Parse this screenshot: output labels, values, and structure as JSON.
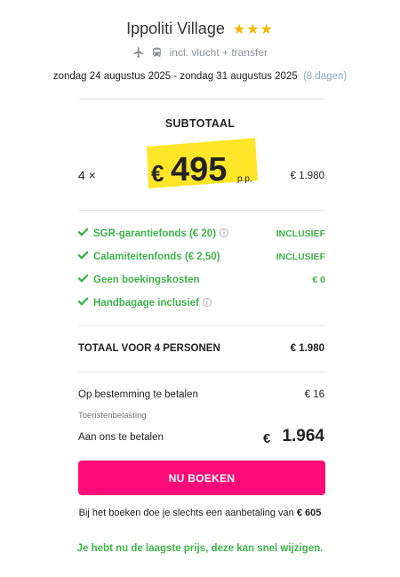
{
  "hotel": {
    "name": "Ippoliti Village",
    "stars": 3,
    "star_glyphs": "★★★"
  },
  "transport": {
    "icons": [
      "plane-icon",
      "bus-icon"
    ],
    "label": "incl. vlucht + transfer"
  },
  "dates": {
    "range": "zondag 24 augustus 2025 - zondag 31 augustus 2025",
    "duration": "(8 dagen)"
  },
  "subtotal": {
    "label": "SUBTOTAAL",
    "quantity": "4 ×",
    "currency": "€",
    "price_per_person": "495",
    "per_person_label": "p.p.",
    "line_total": "€ 1.980"
  },
  "inclusions": [
    {
      "label": "SGR-garantiefonds  (€ 20)",
      "info": true,
      "value": "INCLUSIEF"
    },
    {
      "label": "Calamiteitenfonds  (€ 2,50)",
      "info": false,
      "value": "INCLUSIEF"
    },
    {
      "label": "Geen boekingskosten",
      "info": false,
      "value": "€ 0"
    },
    {
      "label": "Handbagage inclusief",
      "info": true,
      "value": ""
    }
  ],
  "total": {
    "label": "TOTAAL VOOR 4 PERSONEN",
    "value": "€ 1.980"
  },
  "destination": {
    "label": "Op bestemming te betalen",
    "value": "€ 16",
    "note": "Toeristenbelasting"
  },
  "payment": {
    "label": "Aan ons te betalen",
    "currency": "€",
    "value": "1.964"
  },
  "book_button": {
    "label": "NU BOEKEN"
  },
  "deposit": {
    "text": "Bij het boeken doe je slechts een aanbetaling van",
    "amount": "€ 605"
  },
  "lowest_price_note": "Je hebt nu de laagste prijs, deze kan snel wijzigen.",
  "colors": {
    "accent_pink": "#ff0a78",
    "success_green": "#3db54a",
    "highlight_yellow": "#ffe629",
    "star_yellow": "#f5b800",
    "muted_blue": "#8fa6bf"
  }
}
